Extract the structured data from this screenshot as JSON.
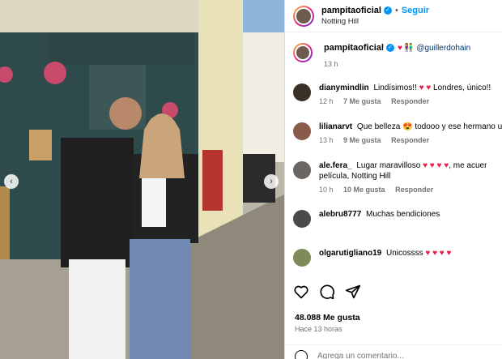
{
  "post": {
    "username": "pampitaoficial",
    "follow_label": "Seguir",
    "location": "Notting Hill",
    "separator": "•"
  },
  "caption": {
    "username": "pampitaoficial",
    "tag": "@guillerdohain",
    "time": "13 h"
  },
  "comments": [
    {
      "user": "dianymindlin",
      "text": "Lindísimos!!",
      "extra": "Londres, único!!",
      "time": "12 h",
      "likes": "7 Me gusta",
      "reply": "Responder"
    },
    {
      "user": "lilianarvt",
      "text": "Que belleza",
      "extra": "todooo y ese hermano u",
      "time": "13 h",
      "likes": "9 Me gusta",
      "reply": "Responder"
    },
    {
      "user": "ale.fera_",
      "text": "Lugar maravilloso",
      "extra": ", me acuer",
      "line2": "película, Notting Hill",
      "time": "10 h",
      "likes": "10 Me gusta",
      "reply": "Responder"
    },
    {
      "user": "alebru8777",
      "text": "Muchas bendiciones",
      "time": "",
      "likes": "",
      "reply": ""
    },
    {
      "user": "olgarutigliano19",
      "text": "Únicossss",
      "time": "",
      "likes": "",
      "reply": ""
    }
  ],
  "footer": {
    "likes": "48.088 Me gusta",
    "ago": "Hace 13 horas",
    "comment_placeholder": "Agrega un comentario..."
  },
  "colors": {
    "accent": "#0095f6",
    "heart": "#ed1c4a",
    "meta": "#737373"
  }
}
